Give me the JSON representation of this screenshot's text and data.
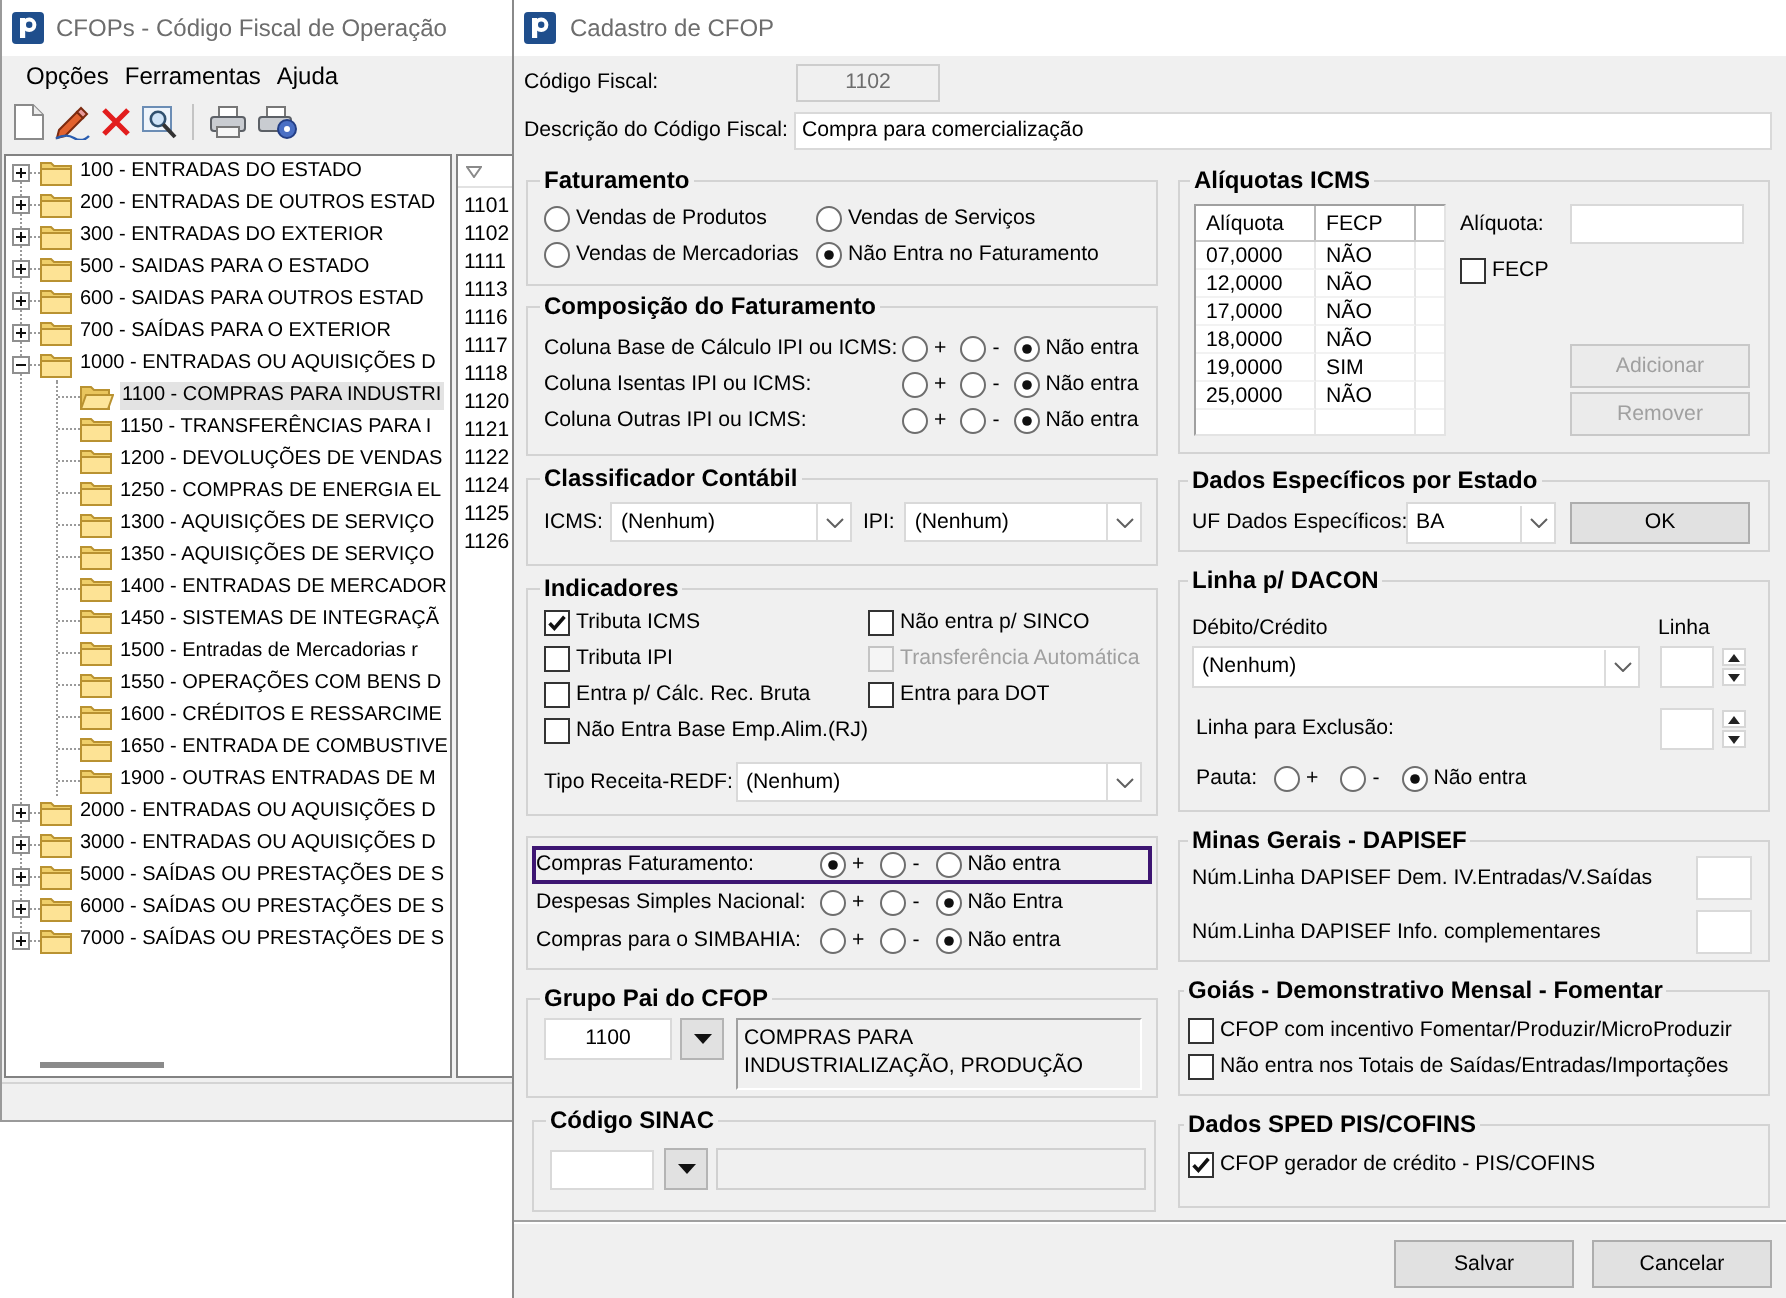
{
  "background_window": {
    "title": "CFOPs - Código Fiscal de Operação",
    "menu": [
      "Opções",
      "Ferramentas",
      "Ajuda"
    ],
    "tree": [
      {
        "label": "100 - ENTRADAS DO ESTADO",
        "expanded": false,
        "selected": false
      },
      {
        "label": "200 - ENTRADAS DE OUTROS ESTAD",
        "expanded": false,
        "selected": false
      },
      {
        "label": "300 - ENTRADAS DO EXTERIOR",
        "expanded": false,
        "selected": false
      },
      {
        "label": "500 - SAIDAS PARA O ESTADO",
        "expanded": false,
        "selected": false
      },
      {
        "label": "600 - SAIDAS PARA OUTROS ESTAD",
        "expanded": false,
        "selected": false
      },
      {
        "label": "700 - SAÍDAS PARA O EXTERIOR",
        "expanded": false,
        "selected": false
      },
      {
        "label": "1000 - ENTRADAS OU AQUISIÇÕES D",
        "expanded": true,
        "selected": false,
        "children": [
          {
            "label": "1100 - COMPRAS PARA INDUSTRI",
            "selected": true
          },
          {
            "label": "1150 - TRANSFERÊNCIAS PARA I",
            "selected": false
          },
          {
            "label": "1200 - DEVOLUÇÕES DE VENDAS",
            "selected": false
          },
          {
            "label": "1250 - COMPRAS DE ENERGIA EL",
            "selected": false
          },
          {
            "label": "1300 - AQUISIÇÕES DE SERVIÇO",
            "selected": false
          },
          {
            "label": "1350 - AQUISIÇÕES DE SERVIÇO",
            "selected": false
          },
          {
            "label": "1400 - ENTRADAS DE MERCADOR",
            "selected": false
          },
          {
            "label": "1450 - SISTEMAS DE INTEGRAÇÃ",
            "selected": false
          },
          {
            "label": "1500 - Entradas de Mercadorias r",
            "selected": false
          },
          {
            "label": "1550 - OPERAÇÕES COM BENS D",
            "selected": false
          },
          {
            "label": "1600 - CRÉDITOS E RESSARCIME",
            "selected": false
          },
          {
            "label": "1650 - ENTRADA DE COMBUSTIVE",
            "selected": false
          },
          {
            "label": "1900 - OUTRAS ENTRADAS DE M",
            "selected": false
          }
        ]
      },
      {
        "label": "2000 - ENTRADAS OU AQUISIÇÕES D",
        "expanded": false,
        "selected": false
      },
      {
        "label": "3000 - ENTRADAS OU AQUISIÇÕES D",
        "expanded": false,
        "selected": false
      },
      {
        "label": "5000 - SAÍDAS OU PRESTAÇÕES DE S",
        "expanded": false,
        "selected": false
      },
      {
        "label": "6000 - SAÍDAS OU PRESTAÇÕES DE S",
        "expanded": false,
        "selected": false
      },
      {
        "label": "7000 - SAÍDAS OU PRESTAÇÕES DE S",
        "expanded": false,
        "selected": false
      }
    ],
    "list": {
      "rows": [
        "1101",
        "1102",
        "1111",
        "1113",
        "1116",
        "1117",
        "1118",
        "1120",
        "1121",
        "1122",
        "1124",
        "1125",
        "1126"
      ]
    }
  },
  "dialog": {
    "title": "Cadastro de CFOP",
    "codigo_fiscal": {
      "label": "Código Fiscal:",
      "value": "1102",
      "disabled": true
    },
    "descricao": {
      "label": "Descrição do Código Fiscal:",
      "value": "Compra para comercialização"
    },
    "faturamento": {
      "title": "Faturamento",
      "options": [
        {
          "label": "Vendas de Produtos",
          "selected": false
        },
        {
          "label": "Vendas de Serviços",
          "selected": false
        },
        {
          "label": "Vendas de Mercadorias",
          "selected": false
        },
        {
          "label": "Não Entra no Faturamento",
          "selected": true
        }
      ]
    },
    "composicao": {
      "title": "Composição do Faturamento",
      "rows": [
        {
          "label": "Coluna Base de Cálculo IPI ou ICMS:",
          "options": [
            {
              "label": "+",
              "selected": false
            },
            {
              "label": "-",
              "selected": false
            },
            {
              "label": "Não entra",
              "selected": true
            }
          ]
        },
        {
          "label": "Coluna Isentas IPI ou ICMS:",
          "options": [
            {
              "label": "+",
              "selected": false
            },
            {
              "label": "-",
              "selected": false
            },
            {
              "label": "Não entra",
              "selected": true
            }
          ]
        },
        {
          "label": "Coluna Outras IPI ou ICMS:",
          "options": [
            {
              "label": "+",
              "selected": false
            },
            {
              "label": "-",
              "selected": false
            },
            {
              "label": "Não entra",
              "selected": true
            }
          ]
        }
      ]
    },
    "classificador": {
      "title": "Classificador Contábil",
      "fields": [
        {
          "label": "ICMS:",
          "value": "(Nenhum)"
        },
        {
          "label": "IPI:",
          "value": "(Nenhum)"
        }
      ]
    },
    "indicadores": {
      "title": "Indicadores",
      "checkboxes": [
        {
          "label": "Tributa ICMS",
          "checked": true,
          "disabled": false
        },
        {
          "label": "Não entra p/ SINCO",
          "checked": false,
          "disabled": false
        },
        {
          "label": "Tributa IPI",
          "checked": false,
          "disabled": false
        },
        {
          "label": "Transferência Automática",
          "checked": false,
          "disabled": true
        },
        {
          "label": "Entra p/ Cálc. Rec. Bruta",
          "checked": false,
          "disabled": false
        },
        {
          "label": "Entra para DOT",
          "checked": false,
          "disabled": false
        },
        {
          "label": "Não Entra Base Emp.Alim.(RJ)",
          "checked": false,
          "disabled": false
        }
      ],
      "tipo_receita": {
        "label": "Tipo Receita-REDF:",
        "value": "(Nenhum)"
      }
    },
    "compras": {
      "rows": [
        {
          "label": "Compras Faturamento:",
          "focused": true,
          "options": [
            {
              "label": "+",
              "selected": true
            },
            {
              "label": "-",
              "selected": false
            },
            {
              "label": "Não entra",
              "selected": false
            }
          ]
        },
        {
          "label": "Despesas Simples Nacional:",
          "focused": false,
          "options": [
            {
              "label": "+",
              "selected": false
            },
            {
              "label": "-",
              "selected": false
            },
            {
              "label": "Não Entra",
              "selected": true
            }
          ]
        },
        {
          "label": "Compras para o SIMBAHIA:",
          "focused": false,
          "options": [
            {
              "label": "+",
              "selected": false
            },
            {
              "label": "-",
              "selected": false
            },
            {
              "label": "Não entra",
              "selected": true
            }
          ]
        }
      ]
    },
    "grupo_pai": {
      "title": "Grupo Pai do CFOP",
      "code": "1100",
      "description": "COMPRAS PARA INDUSTRIALIZAÇÃO, PRODUÇÃO"
    },
    "codigo_sinac": {
      "title": "Código SINAC"
    },
    "aliquotas": {
      "title": "Alíquotas ICMS",
      "table": {
        "columns": [
          "Alíquota",
          "FECP"
        ],
        "rows": [
          [
            "07,0000",
            "NÃO"
          ],
          [
            "12,0000",
            "NÃO"
          ],
          [
            "17,0000",
            "NÃO"
          ],
          [
            "18,0000",
            "NÃO"
          ],
          [
            "19,0000",
            "SIM"
          ],
          [
            "25,0000",
            "NÃO"
          ]
        ]
      },
      "aliquota_label": "Alíquota:",
      "fecp": {
        "label": "FECP",
        "checked": false
      },
      "buttons": [
        {
          "label": "Adicionar",
          "disabled": true
        },
        {
          "label": "Remover",
          "disabled": true
        }
      ]
    },
    "dados_estado": {
      "title": "Dados Específicos por Estado",
      "label": "UF Dados Específicos:",
      "value": "BA",
      "button": "OK"
    },
    "dacon": {
      "title": "Linha p/ DACON",
      "debito_label": "Débito/Crédito",
      "debito_value": "(Nenhum)",
      "linha_label": "Linha",
      "exclusao_label": "Linha para Exclusão:",
      "pauta": {
        "label": "Pauta:",
        "options": [
          {
            "label": "+",
            "selected": false
          },
          {
            "label": "-",
            "selected": false
          },
          {
            "label": "Não entra",
            "selected": true
          }
        ]
      }
    },
    "dapisef": {
      "title": "Minas Gerais - DAPISEF",
      "rows": [
        "Núm.Linha DAPISEF Dem. IV.Entradas/V.Saídas",
        "Núm.Linha DAPISEF Info. complementares"
      ]
    },
    "goias": {
      "title": "Goiás - Demonstrativo Mensal - Fomentar",
      "checkboxes": [
        {
          "label": "CFOP com incentivo Fomentar/Produzir/MicroProduzir",
          "checked": false
        },
        {
          "label": "Não entra nos Totais de Saídas/Entradas/Importações",
          "checked": false
        }
      ]
    },
    "sped": {
      "title": "Dados SPED PIS/COFINS",
      "checkboxes": [
        {
          "label": "CFOP gerador de crédito - PIS/COFINS",
          "checked": true
        }
      ]
    },
    "buttons": [
      "Salvar",
      "Cancelar"
    ]
  }
}
